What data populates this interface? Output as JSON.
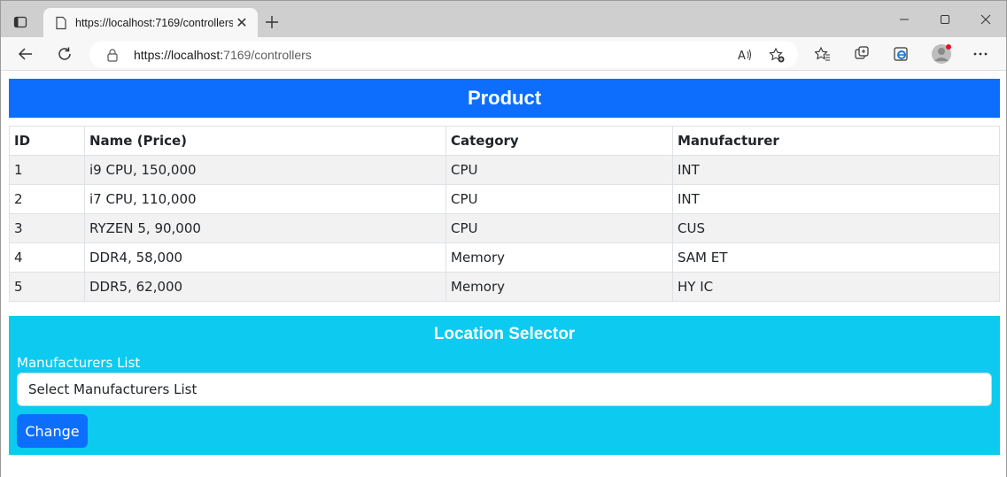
{
  "browser": {
    "tab_title": "https://localhost:7169/controllers",
    "url_host": "https://localhost:",
    "url_rest": "7169/controllers",
    "tab_close_glyph": "✕",
    "new_tab_glyph": "+"
  },
  "icons": [
    "tab-actions-icon",
    "favicon-icon",
    "close-icon",
    "plus-icon",
    "minimize-icon",
    "maximize-icon",
    "window-close-icon",
    "back-icon",
    "refresh-icon",
    "lock-icon",
    "read-aloud-icon",
    "add-favorite-icon",
    "favorites-icon",
    "collections-icon",
    "ie-mode-icon",
    "profile-icon",
    "more-icon"
  ],
  "page": {
    "banner_title": "Product",
    "table": {
      "headers": [
        "ID",
        "Name (Price)",
        "Category",
        "Manufacturer"
      ],
      "rows": [
        [
          "1",
          "i9 CPU, 150,000",
          "CPU",
          "INT"
        ],
        [
          "2",
          "i7 CPU, 110,000",
          "CPU",
          "INT"
        ],
        [
          "3",
          "RYZEN 5, 90,000",
          "CPU",
          "CUS"
        ],
        [
          "4",
          "DDR4, 58,000",
          "Memory",
          "SAM ET"
        ],
        [
          "5",
          "DDR5, 62,000",
          "Memory",
          "HY IC"
        ]
      ]
    },
    "selector": {
      "title": "Location Selector",
      "label": "Manufacturers List",
      "select_value": "Select Manufacturers List",
      "button_label": "Change"
    }
  },
  "colors": {
    "primary": "#0d6efd",
    "info": "#0dcaf0",
    "stripe": "#f2f2f2"
  }
}
